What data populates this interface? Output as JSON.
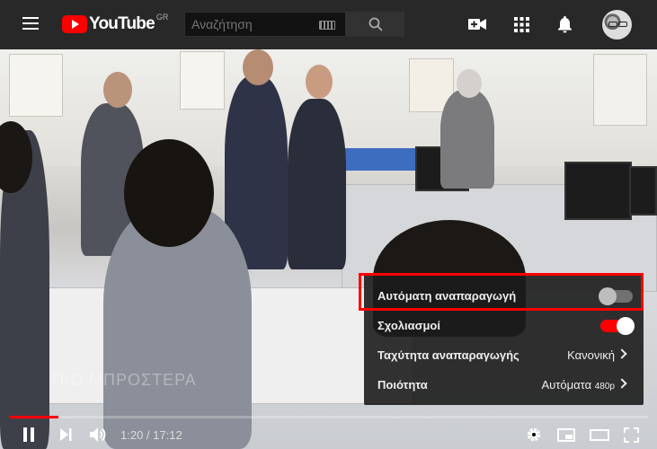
{
  "header": {
    "logo_text": "YouTube",
    "logo_country": "GR",
    "search_placeholder": "Αναζήτηση"
  },
  "video": {
    "watermark": "ΠΙΟ ΜΠΡΟΣΤΕΡΑ",
    "current_time": "1:20",
    "time_separator": " / ",
    "duration": "17:12",
    "progress_fraction": 0.077,
    "buffered_fraction": 0.077
  },
  "settings_menu": {
    "autoplay": {
      "label": "Αυτόματη αναπαραγωγή",
      "enabled": false
    },
    "annotations": {
      "label": "Σχολιασμοί",
      "enabled": true
    },
    "speed": {
      "label": "Ταχύτητα αναπαραγωγής",
      "value": "Κανονική"
    },
    "quality": {
      "label": "Ποιότητα",
      "value": "Αυτόματα",
      "value_detail": "480p"
    }
  },
  "colors": {
    "accent_red": "#ff0000",
    "topbar_bg": "#282828"
  }
}
